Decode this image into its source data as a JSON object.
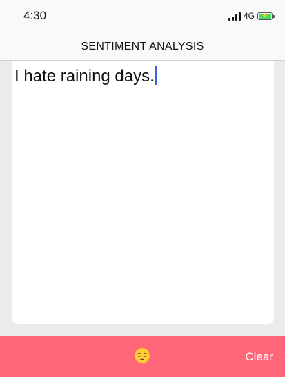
{
  "status_bar": {
    "time": "4:30",
    "network": "4G",
    "battery_icon": "battery-charging-icon",
    "signal_icon": "signal-bars-icon"
  },
  "nav": {
    "title": "SENTIMENT ANALYSIS"
  },
  "editor": {
    "text": "I hate raining days."
  },
  "footer": {
    "sentiment_icon": "pensive-face-emoji",
    "clear_label": "Clear"
  },
  "colors": {
    "accent": "#ff6678",
    "caret": "#3b63e0",
    "background": "#ececec",
    "card": "#ffffff",
    "battery": "#4cd964"
  }
}
